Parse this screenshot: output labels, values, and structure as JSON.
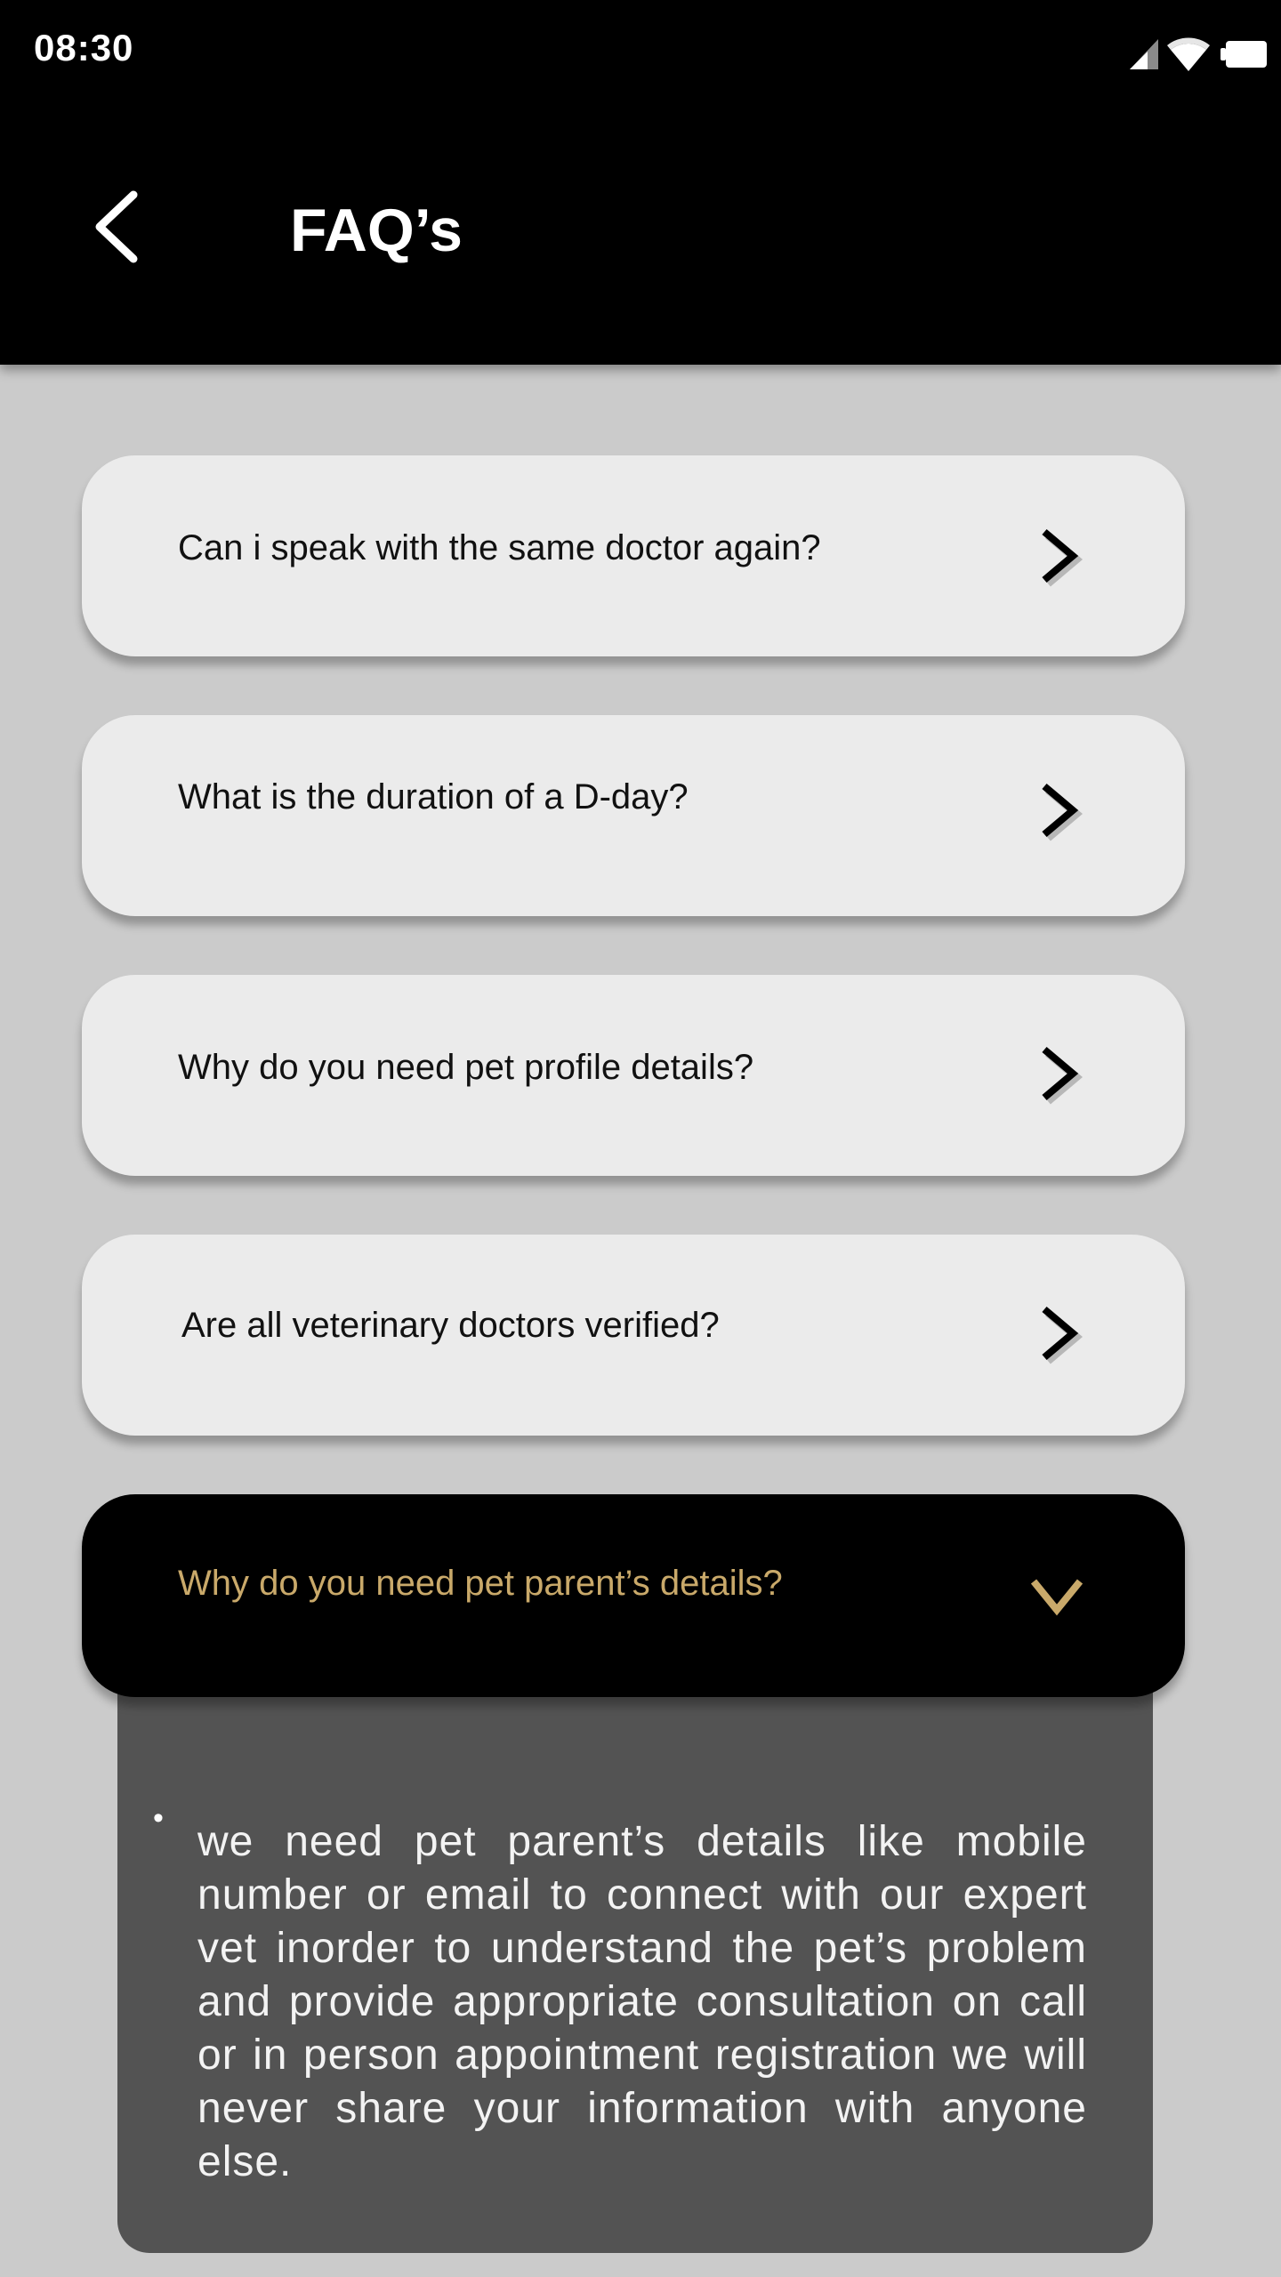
{
  "status_bar": {
    "time": "08:30",
    "icons": [
      "signal-icon",
      "wifi-icon",
      "battery-icon"
    ]
  },
  "header": {
    "title": "FAQ’s",
    "back_icon": "chevron-left-icon"
  },
  "colors": {
    "header_bg": "#000000",
    "page_bg": "#cbcbcb",
    "card_bg": "#ebebeb",
    "active_card_bg": "#000000",
    "accent_gold": "#c9a96a",
    "answer_bg": "#535353"
  },
  "faqs": [
    {
      "question": "Can i speak with the same doctor again?",
      "expanded": false
    },
    {
      "question": "What is the duration of a D-day?",
      "expanded": false
    },
    {
      "question": "Why do you need pet profile details?",
      "expanded": false
    },
    {
      "question": "Are all veterinary doctors verified?",
      "expanded": false
    },
    {
      "question": "Why do you need pet parent’s details?",
      "expanded": true,
      "answer": "we need pet parent’s details like mobile number or email to connect with our expert vet inorder to understand the pet’s problem and provide appropriate consultation on call or in person appointment registration we will never share your information with anyone else."
    }
  ]
}
